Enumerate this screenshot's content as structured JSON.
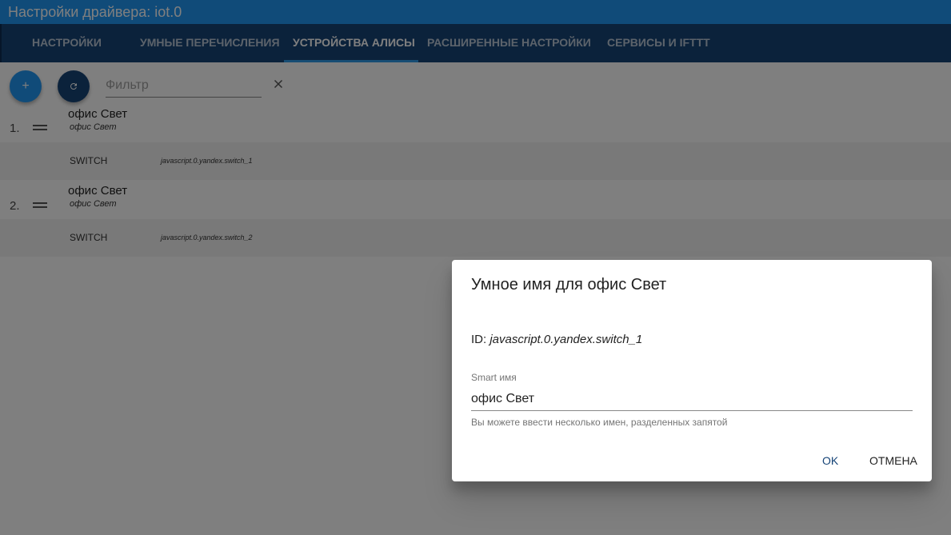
{
  "window": {
    "title": "Настройки драйвера: iot.0"
  },
  "tabs": [
    {
      "label": "НАСТРОЙКИ"
    },
    {
      "label": "УМНЫЕ ПЕРЕЧИСЛЕНИЯ"
    },
    {
      "label": "УСТРОЙСТВА АЛИСЫ",
      "active": true
    },
    {
      "label": "РАСШИРЕННЫЕ НАСТРОЙКИ"
    },
    {
      "label": "СЕРВИСЫ И IFTTT"
    }
  ],
  "toolbar": {
    "add_icon": "+",
    "refresh_icon": "refresh-icon",
    "filter_placeholder": "Фильтр",
    "clear_icon": "close-icon"
  },
  "devices": [
    {
      "num": "1.",
      "name": "офис Свет",
      "smart_name": "офис Свет",
      "type": "SWITCH",
      "id": "javascript.0.yandex.switch_1"
    },
    {
      "num": "2.",
      "name": "офис Свет",
      "smart_name": "офис Свет",
      "type": "SWITCH",
      "id": "javascript.0.yandex.switch_2"
    }
  ],
  "dialog": {
    "title": "Умное имя для офис Свет",
    "id_label": "ID: ",
    "id_value": "javascript.0.yandex.switch_1",
    "field_label": "Smart имя",
    "field_value": "офис Свет",
    "helper": "Вы можете ввести несколько имен, разделенных запятой",
    "ok_label": "OK",
    "cancel_label": "ОТМЕНА"
  },
  "colors": {
    "primary": "#2196f3",
    "tabs_bg": "#164477",
    "overlay": "rgba(0,0,0,0.5)"
  }
}
